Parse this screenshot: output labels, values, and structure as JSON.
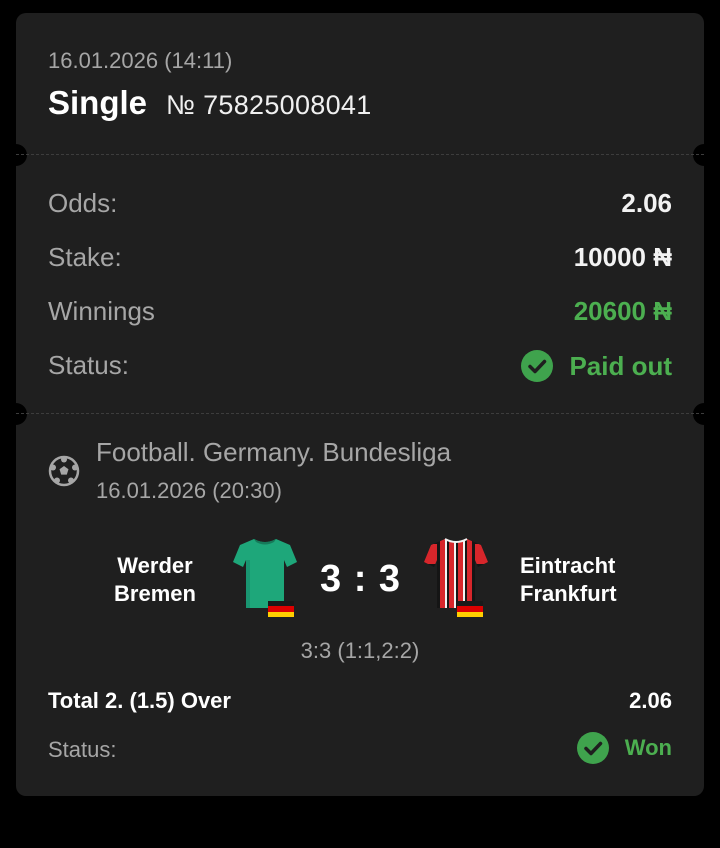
{
  "header": {
    "placed_at": "16.01.2026 (14:11)",
    "bet_type": "Single",
    "bet_number": "№ 75825008041"
  },
  "summary": {
    "odds_label": "Odds:",
    "odds_value": "2.06",
    "stake_label": "Stake:",
    "stake_value": "10000 ₦",
    "winnings_label": "Winnings",
    "winnings_value": "20600 ₦",
    "status_label": "Status:",
    "status_value": "Paid out"
  },
  "event": {
    "sport_icon": "football-icon",
    "league": "Football. Germany. Bundesliga",
    "start_time": "16.01.2026 (20:30)",
    "home_team": "Werder Bremen",
    "away_team": "Eintracht Frankfurt",
    "score": "3 : 3",
    "score_detail": "3:3 (1:1,2:2)",
    "market": "Total 2. (1.5) Over",
    "market_odds": "2.06",
    "status_label": "Status:",
    "status_value": "Won"
  },
  "colors": {
    "background": "#000000",
    "card": "#1f1f1f",
    "success": "#4caf50",
    "muted_text": "#a6a6a6"
  }
}
